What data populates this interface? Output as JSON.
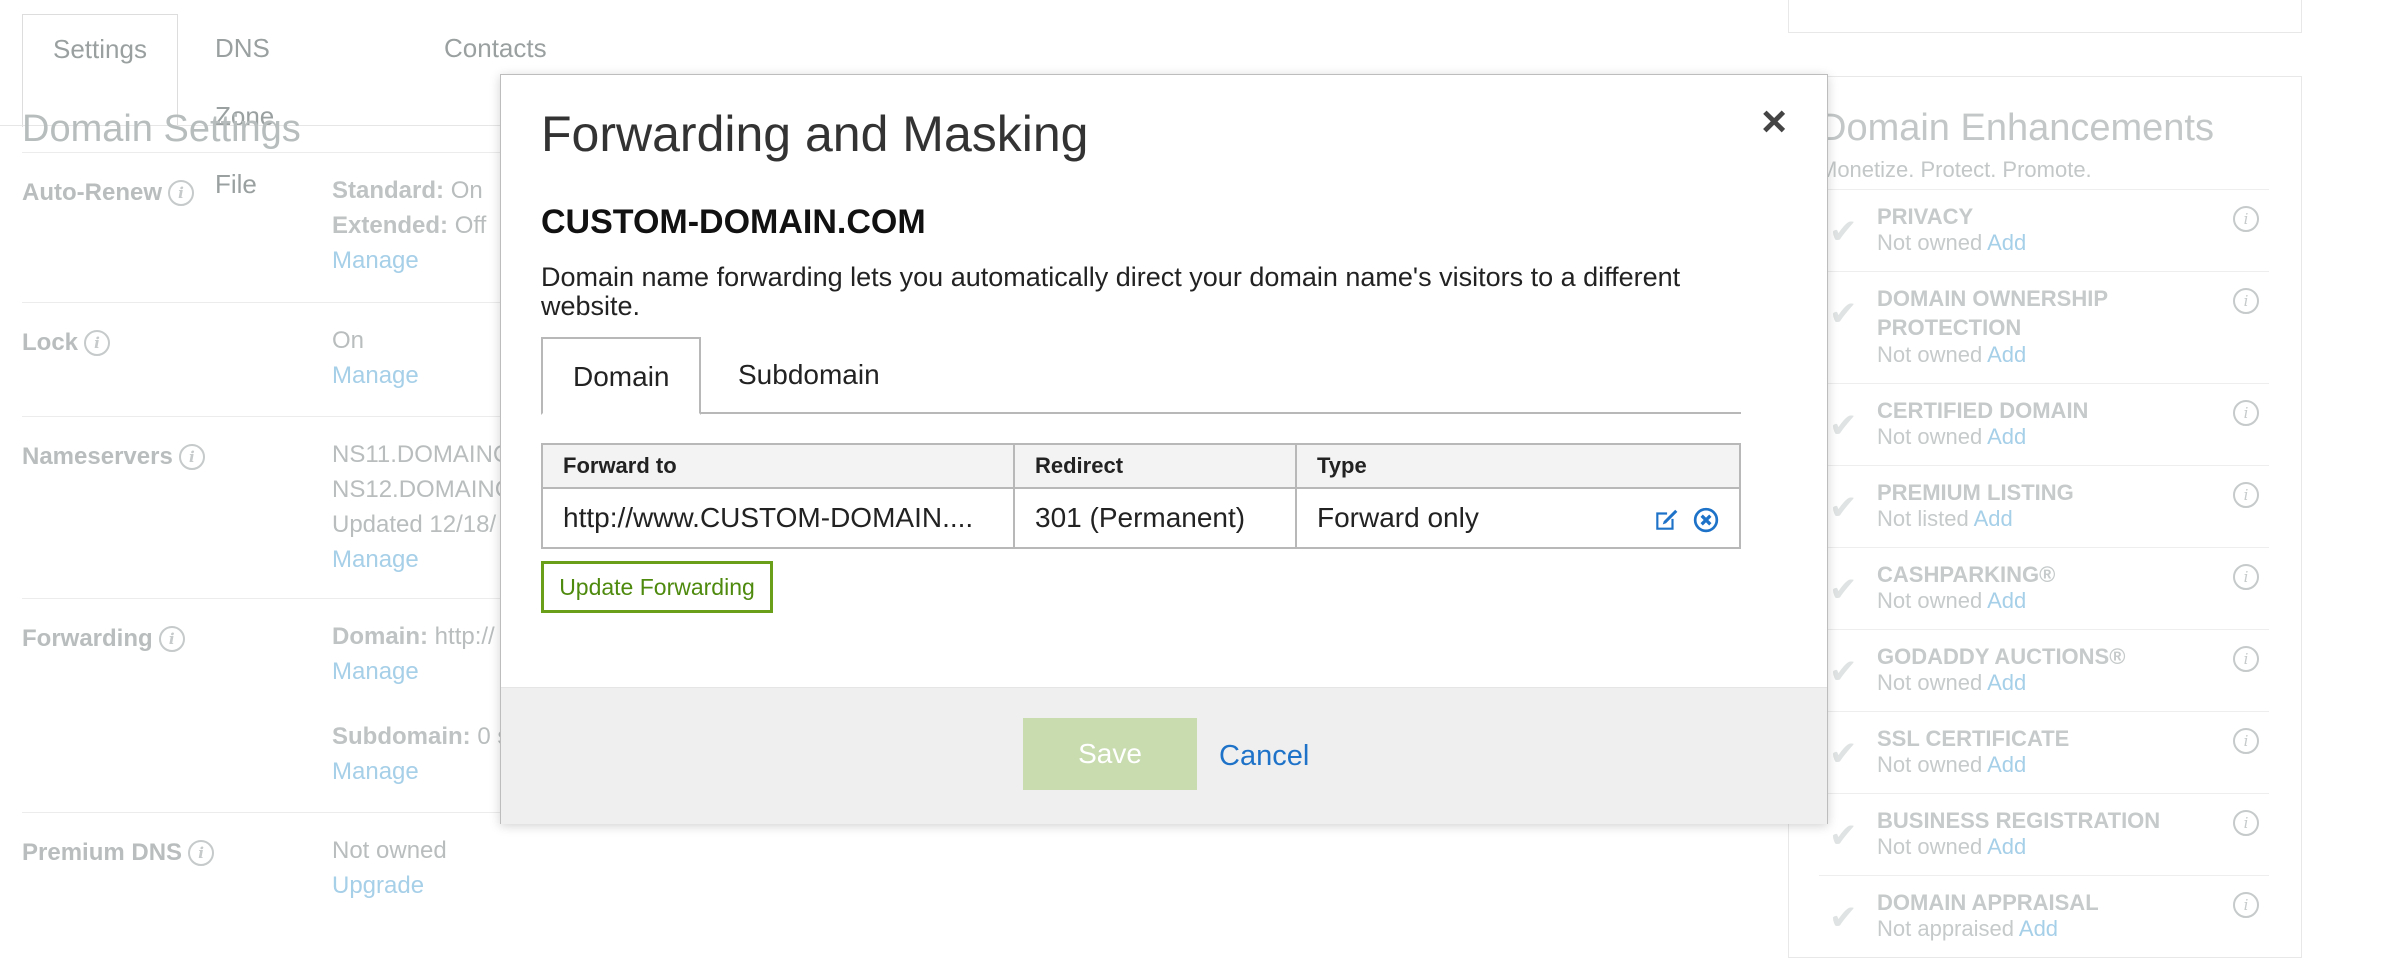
{
  "tabs": [
    {
      "label": "Settings",
      "active": true
    },
    {
      "label": "DNS Zone File",
      "active": false
    },
    {
      "label": "Contacts",
      "active": false
    }
  ],
  "domain_settings": {
    "title": "Domain Settings",
    "rows": [
      {
        "label": "Auto-Renew",
        "lines": [
          {
            "key": "Standard:",
            "value": "On"
          },
          {
            "key": "Extended:",
            "value": "Off"
          }
        ],
        "link": "Manage"
      },
      {
        "label": "Lock",
        "value": "On",
        "link": "Manage"
      },
      {
        "label": "Nameservers",
        "values": [
          "NS11.DOMAINC",
          "NS12.DOMAINC",
          "Updated 12/18/"
        ],
        "link": "Manage"
      },
      {
        "label": "Forwarding",
        "domain_key": "Domain:",
        "domain_value": "http://",
        "link1": "Manage",
        "subdomain_key": "Subdomain:",
        "subdomain_value": "0 s",
        "link2": "Manage"
      },
      {
        "label": "Premium DNS",
        "value": "Not owned",
        "link": "Upgrade"
      }
    ]
  },
  "enhancements": {
    "title": "Domain Enhancements",
    "subtitle": "Monetize. Protect. Promote.",
    "items": [
      {
        "name": "PRIVACY",
        "status": "Not owned",
        "action": "Add"
      },
      {
        "name": "DOMAIN OWNERSHIP PROTECTION",
        "status": "Not owned",
        "action": "Add"
      },
      {
        "name": "CERTIFIED DOMAIN",
        "status": "Not owned",
        "action": "Add"
      },
      {
        "name": "PREMIUM LISTING",
        "status": "Not listed",
        "action": "Add"
      },
      {
        "name": "CASHPARKING®",
        "status": "Not owned",
        "action": "Add"
      },
      {
        "name": "GODADDY AUCTIONS®",
        "status": "Not owned",
        "action": "Add"
      },
      {
        "name": "SSL CERTIFICATE",
        "status": "Not owned",
        "action": "Add"
      },
      {
        "name": "BUSINESS REGISTRATION",
        "status": "Not owned",
        "action": "Add"
      },
      {
        "name": "DOMAIN APPRAISAL",
        "status": "Not appraised",
        "action": "Add"
      }
    ]
  },
  "modal": {
    "title": "Forwarding and Masking",
    "close": "×",
    "domain": "CUSTOM-DOMAIN.COM",
    "description": "Domain name forwarding lets you automatically direct your domain name's visitors to a different website.",
    "tabs": [
      "Domain",
      "Subdomain"
    ],
    "table": {
      "headers": [
        "Forward to",
        "Redirect",
        "Type"
      ],
      "rows": [
        [
          "http://www.CUSTOM-DOMAIN....",
          "301 (Permanent)",
          "Forward only"
        ]
      ]
    },
    "update_button": "Update Forwarding",
    "save_button": "Save",
    "cancel_link": "Cancel"
  },
  "colors": {
    "accent_green": "#6a9f1a",
    "link_blue": "#1e73c9",
    "action_icon_blue": "#1e73c9"
  },
  "icons": [
    "info-icon",
    "check-icon",
    "edit-icon",
    "remove-icon",
    "close-icon"
  ]
}
